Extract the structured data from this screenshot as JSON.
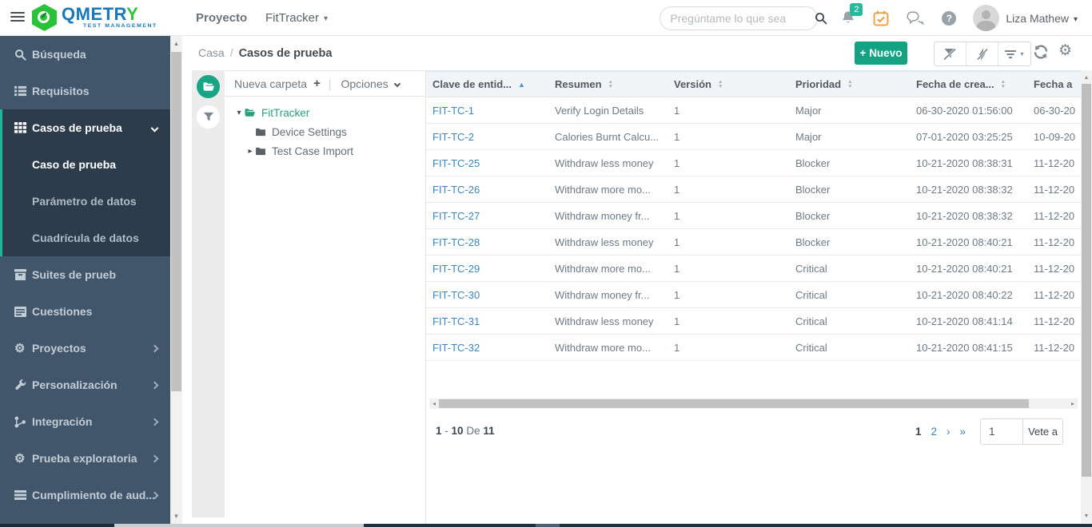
{
  "topbar": {
    "logo_main": "QMETR",
    "logo_y": "Y",
    "logo_sub": "TEST MANAGEMENT",
    "project_label": "Proyecto",
    "project_value": "FitTracker",
    "search_placeholder": "Pregúntame lo que sea",
    "notification_count": "2",
    "user_name": "Liza Mathew"
  },
  "sidebar": {
    "items": [
      {
        "label": "Búsqueda"
      },
      {
        "label": "Requisitos"
      },
      {
        "label": "Casos de prueba"
      },
      {
        "label": "Caso de prueba"
      },
      {
        "label": "Parámetro de datos"
      },
      {
        "label": "Cuadrícula de datos"
      },
      {
        "label": "Suites de prueb"
      },
      {
        "label": "Cuestiones"
      },
      {
        "label": "Proyectos"
      },
      {
        "label": "Personalización"
      },
      {
        "label": "Integración"
      },
      {
        "label": "Prueba exploratoria"
      },
      {
        "label": "Cumplimiento de aud..."
      }
    ]
  },
  "breadcrumb": {
    "home": "Casa",
    "separator": "/",
    "current": "Casos de prueba"
  },
  "toolbar": {
    "new_button": "Nuevo"
  },
  "tree": {
    "new_folder_label": "Nueva carpeta",
    "options_label": "Opciones",
    "root": "FitTracker",
    "children": [
      {
        "label": "Device Settings"
      },
      {
        "label": "Test Case Import"
      }
    ]
  },
  "table": {
    "columns": [
      {
        "label": "Clave de entid...",
        "sort": "asc"
      },
      {
        "label": "Resumen",
        "sort": "none"
      },
      {
        "label": "Versión",
        "sort": "none"
      },
      {
        "label": "Prioridad",
        "sort": "none"
      },
      {
        "label": "Fecha de crea...",
        "sort": "none"
      },
      {
        "label": "Fecha a",
        "sort": "none"
      }
    ],
    "rows": [
      {
        "key": "FIT-TC-1",
        "summary": "Verify Login Details",
        "version": "1",
        "priority": "Major",
        "created": "06-30-2020 01:56:00",
        "modified": "06-30-20"
      },
      {
        "key": "FIT-TC-2",
        "summary": "Calories Burnt Calcu...",
        "version": "1",
        "priority": "Major",
        "created": "07-01-2020 03:25:25",
        "modified": "10-09-20"
      },
      {
        "key": "FIT-TC-25",
        "summary": "Withdraw less money",
        "version": "1",
        "priority": "Blocker",
        "created": "10-21-2020 08:38:31",
        "modified": "11-12-20"
      },
      {
        "key": "FIT-TC-26",
        "summary": "Withdraw more mo...",
        "version": "1",
        "priority": "Blocker",
        "created": "10-21-2020 08:38:32",
        "modified": "11-12-20"
      },
      {
        "key": "FIT-TC-27",
        "summary": "Withdraw money fr...",
        "version": "1",
        "priority": "Blocker",
        "created": "10-21-2020 08:38:32",
        "modified": "11-12-20"
      },
      {
        "key": "FIT-TC-28",
        "summary": "Withdraw less money",
        "version": "1",
        "priority": "Blocker",
        "created": "10-21-2020 08:40:21",
        "modified": "11-12-20"
      },
      {
        "key": "FIT-TC-29",
        "summary": "Withdraw more mo...",
        "version": "1",
        "priority": "Critical",
        "created": "10-21-2020 08:40:21",
        "modified": "11-12-20"
      },
      {
        "key": "FIT-TC-30",
        "summary": "Withdraw money fr...",
        "version": "1",
        "priority": "Critical",
        "created": "10-21-2020 08:40:22",
        "modified": "11-12-20"
      },
      {
        "key": "FIT-TC-31",
        "summary": "Withdraw less money",
        "version": "1",
        "priority": "Critical",
        "created": "10-21-2020 08:41:14",
        "modified": "11-12-20"
      },
      {
        "key": "FIT-TC-32",
        "summary": "Withdraw more mo...",
        "version": "1",
        "priority": "Critical",
        "created": "10-21-2020 08:41:15",
        "modified": "11-12-20"
      }
    ]
  },
  "pagination": {
    "start": "1",
    "dash": "-",
    "end": "10",
    "of": "De",
    "total": "11",
    "page_current": "1",
    "page_2": "2",
    "next": "›",
    "last": "»",
    "goto_value": "1",
    "goto_label": "Vete a"
  },
  "icons": {
    "plus": "+",
    "caret_down": "▾",
    "caret_right": "▸",
    "sort_asc": "▲",
    "sort_desc": "▼",
    "question": "?",
    "left_tri": "◂",
    "right_tri": "▸",
    "up_tri": "▲",
    "down_tri": "▼",
    "gear": "⚙",
    "divider": "|"
  },
  "colors": {
    "brand_green": "#14a283",
    "sidebar_bg": "#42566b",
    "sidebar_active_bg": "#2d3c4b",
    "accent_teal": "#1db79c",
    "link_blue": "#3d85b8",
    "badge_green": "#26b99a",
    "calendar_orange": "#ef9d3e",
    "logo_blue": "#1878b9",
    "logo_green": "#2bc138"
  }
}
